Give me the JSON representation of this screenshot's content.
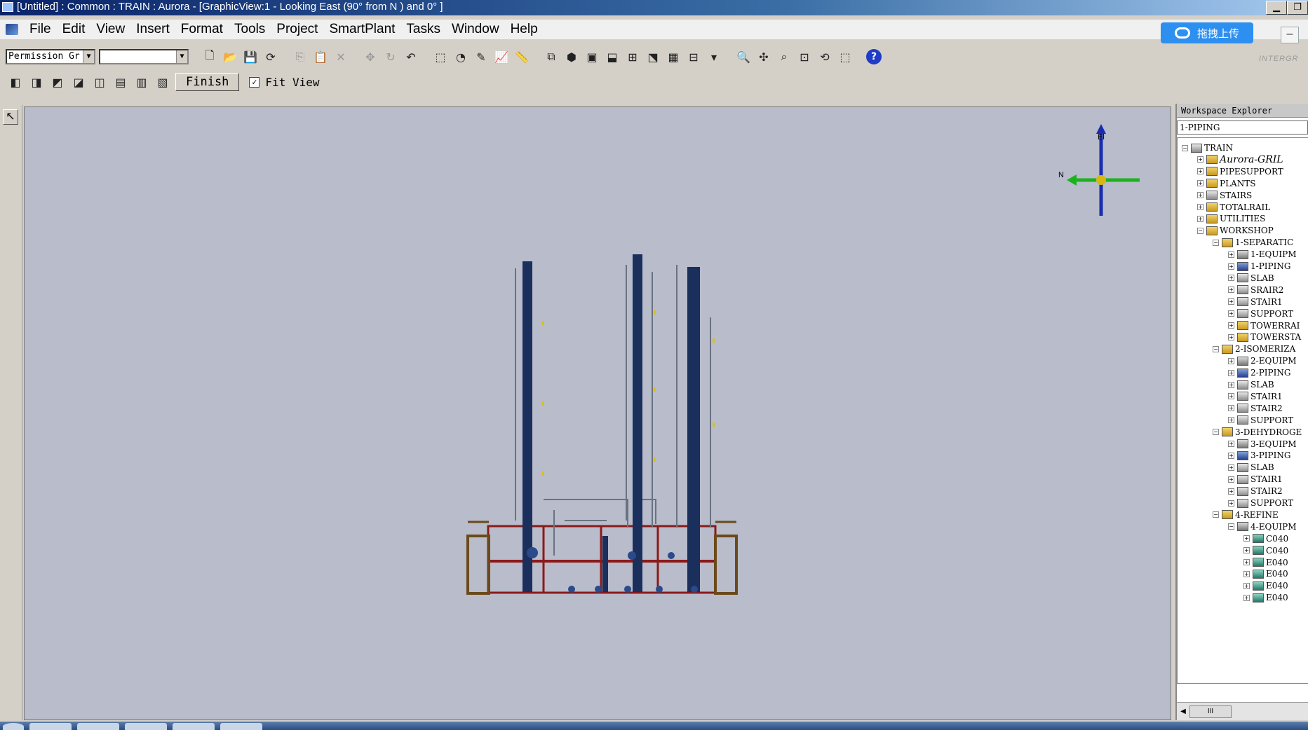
{
  "window": {
    "title": "[Untitled] : Common : TRAIN : Aurora - [GraphicView:1 - Looking East (90° from N ) and 0° ]"
  },
  "menubar": {
    "items": [
      "File",
      "Edit",
      "View",
      "Insert",
      "Format",
      "Tools",
      "Project",
      "SmartPlant",
      "Tasks",
      "Window",
      "Help"
    ]
  },
  "upload": {
    "label": "拖拽上传"
  },
  "toolbar": {
    "permission_combo": "Permission Gr",
    "second_combo": "",
    "finish_label": "Finish",
    "fit_view_label": "Fit View",
    "fit_view_checked": true,
    "brand_text": "INTERGR"
  },
  "compass": {
    "east_label": "El",
    "north_label": "N"
  },
  "explorer": {
    "title": "Workspace Explorer",
    "filter_value": "1-PIPING",
    "tree": [
      {
        "label": "TRAIN",
        "depth": 0,
        "expanded": true,
        "icon": "system"
      },
      {
        "label": "Aurora-GRIL",
        "depth": 1,
        "expanded": false,
        "icon": "folder",
        "italic": true
      },
      {
        "label": "PIPESUPPORT",
        "depth": 1,
        "expanded": false,
        "icon": "folder"
      },
      {
        "label": "PLANTS",
        "depth": 1,
        "expanded": false,
        "icon": "folder"
      },
      {
        "label": "STAIRS",
        "depth": 1,
        "expanded": false,
        "icon": "system"
      },
      {
        "label": "TOTALRAIL",
        "depth": 1,
        "expanded": false,
        "icon": "folder"
      },
      {
        "label": "UTILITIES",
        "depth": 1,
        "expanded": false,
        "icon": "folder"
      },
      {
        "label": "WORKSHOP",
        "depth": 1,
        "expanded": true,
        "icon": "folder"
      },
      {
        "label": "1-SEPARATIC",
        "depth": 2,
        "expanded": true,
        "icon": "folder"
      },
      {
        "label": "1-EQUIPM",
        "depth": 3,
        "expanded": false,
        "icon": "equip"
      },
      {
        "label": "1-PIPING",
        "depth": 3,
        "expanded": false,
        "icon": "piping"
      },
      {
        "label": "SLAB",
        "depth": 3,
        "expanded": false,
        "icon": "system"
      },
      {
        "label": "SRAIR2",
        "depth": 3,
        "expanded": false,
        "icon": "system"
      },
      {
        "label": "STAIR1",
        "depth": 3,
        "expanded": false,
        "icon": "system"
      },
      {
        "label": "SUPPORT",
        "depth": 3,
        "expanded": false,
        "icon": "system"
      },
      {
        "label": "TOWERRAI",
        "depth": 3,
        "expanded": false,
        "icon": "folder"
      },
      {
        "label": "TOWERSTA",
        "depth": 3,
        "expanded": false,
        "icon": "folder"
      },
      {
        "label": "2-ISOMERIZA",
        "depth": 2,
        "expanded": true,
        "icon": "folder"
      },
      {
        "label": "2-EQUIPM",
        "depth": 3,
        "expanded": false,
        "icon": "equip"
      },
      {
        "label": "2-PIPING",
        "depth": 3,
        "expanded": false,
        "icon": "piping"
      },
      {
        "label": "SLAB",
        "depth": 3,
        "expanded": false,
        "icon": "system"
      },
      {
        "label": "STAIR1",
        "depth": 3,
        "expanded": false,
        "icon": "system"
      },
      {
        "label": "STAIR2",
        "depth": 3,
        "expanded": false,
        "icon": "system"
      },
      {
        "label": "SUPPORT",
        "depth": 3,
        "expanded": false,
        "icon": "system"
      },
      {
        "label": "3-DEHYDROGE",
        "depth": 2,
        "expanded": true,
        "icon": "folder"
      },
      {
        "label": "3-EQUIPM",
        "depth": 3,
        "expanded": false,
        "icon": "equip"
      },
      {
        "label": "3-PIPING",
        "depth": 3,
        "expanded": false,
        "icon": "piping"
      },
      {
        "label": "SLAB",
        "depth": 3,
        "expanded": false,
        "icon": "system"
      },
      {
        "label": "STAIR1",
        "depth": 3,
        "expanded": false,
        "icon": "system"
      },
      {
        "label": "STAIR2",
        "depth": 3,
        "expanded": false,
        "icon": "system"
      },
      {
        "label": "SUPPORT",
        "depth": 3,
        "expanded": false,
        "icon": "system"
      },
      {
        "label": "4-REFINE",
        "depth": 2,
        "expanded": true,
        "icon": "folder"
      },
      {
        "label": "4-EQUIPM",
        "depth": 3,
        "expanded": true,
        "icon": "equip"
      },
      {
        "label": "C040",
        "depth": 4,
        "expanded": false,
        "icon": "eqpart"
      },
      {
        "label": "C040",
        "depth": 4,
        "expanded": false,
        "icon": "eqpart"
      },
      {
        "label": "E040",
        "depth": 4,
        "expanded": false,
        "icon": "eqpart"
      },
      {
        "label": "E040",
        "depth": 4,
        "expanded": false,
        "icon": "eqpart"
      },
      {
        "label": "E040",
        "depth": 4,
        "expanded": false,
        "icon": "eqpart"
      },
      {
        "label": "E040",
        "depth": 4,
        "expanded": false,
        "icon": "eqpart"
      }
    ],
    "scroll_thumb": "III"
  },
  "colors": {
    "view_bg": "#b8bccb",
    "tower": "#1b2f5c",
    "frame": "#8b1a1a",
    "accent_blue": "#2d8ff0"
  }
}
